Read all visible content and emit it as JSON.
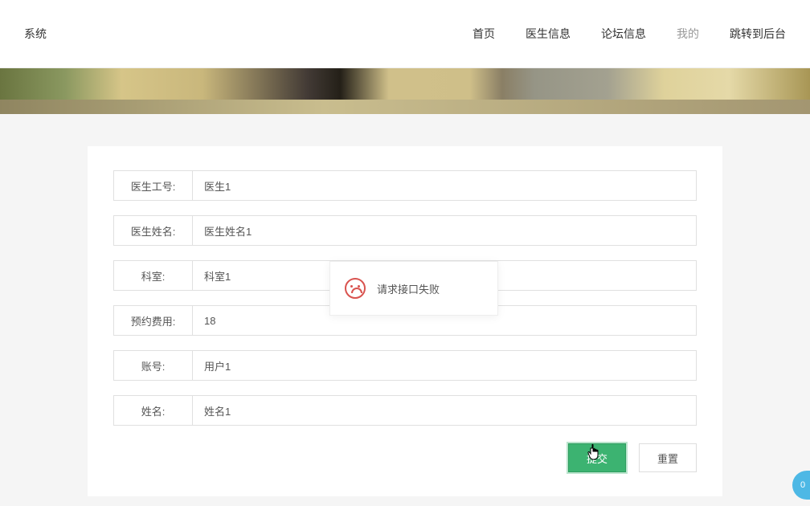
{
  "header": {
    "logo": "系统",
    "nav": [
      {
        "label": "首页",
        "muted": false
      },
      {
        "label": "医生信息",
        "muted": false
      },
      {
        "label": "论坛信息",
        "muted": false
      },
      {
        "label": "我的",
        "muted": true
      },
      {
        "label": "跳转到后台",
        "muted": false
      }
    ]
  },
  "form": {
    "rows": [
      {
        "label": "医生工号:",
        "value": "医生1"
      },
      {
        "label": "医生姓名:",
        "value": "医生姓名1"
      },
      {
        "label": "科室:",
        "value": "科室1"
      },
      {
        "label": "预约费用:",
        "value": "18"
      },
      {
        "label": "账号:",
        "value": "用户1"
      },
      {
        "label": "姓名:",
        "value": "姓名1"
      }
    ],
    "submit_label": "提交",
    "reset_label": "重置"
  },
  "modal": {
    "message": "请求接口失败"
  },
  "float": {
    "text": "0"
  }
}
